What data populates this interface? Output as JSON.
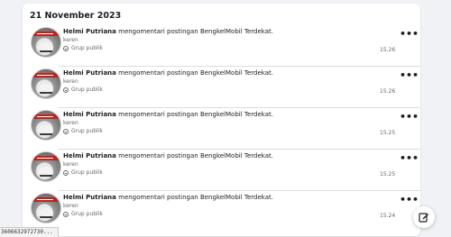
{
  "date_header": "21 November 2023",
  "entries": [
    {
      "actor": "Helmi Putriana",
      "action": "mengomentari postingan BengkelMobil Terdekat.",
      "comment": "keren",
      "audience": "Grup publik",
      "time": "15.26"
    },
    {
      "actor": "Helmi Putriana",
      "action": "mengomentari postingan BengkelMobil Terdekat.",
      "comment": "keren",
      "audience": "Grup publik",
      "time": "15.26"
    },
    {
      "actor": "Helmi Putriana",
      "action": "mengomentari postingan BengkelMobil Terdekat.",
      "comment": "keren",
      "audience": "Grup publik",
      "time": "15.25"
    },
    {
      "actor": "Helmi Putriana",
      "action": "mengomentari postingan BengkelMobil Terdekat.",
      "comment": "keren",
      "audience": "Grup publik",
      "time": "15.25"
    },
    {
      "actor": "Helmi Putriana",
      "action": "mengomentari postingan BengkelMobil Terdekat.",
      "comment": "keren",
      "audience": "Grup publik",
      "time": "15.24"
    }
  ],
  "more_label": "•••",
  "status_url": "3606632972730...",
  "icons": {
    "audience": "globe-icon",
    "more": "more-options-icon",
    "compose": "compose-icon"
  },
  "colors": {
    "background": "#f0f2f5",
    "card": "#ffffff",
    "secondary_text": "#65676b",
    "avatar_band": "#c0221c"
  }
}
